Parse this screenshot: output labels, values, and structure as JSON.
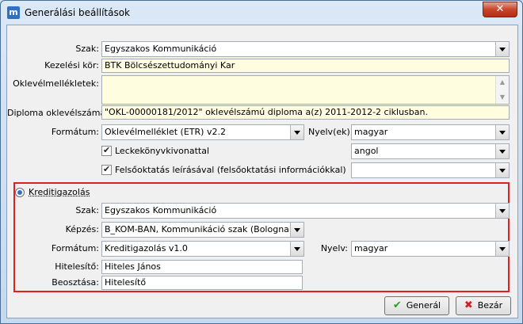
{
  "window": {
    "title": "Generálási beállítások",
    "app_icon_glyph": "m",
    "close_glyph": "✕"
  },
  "form": {
    "szak_label": "Szak:",
    "szak_value": "Egyszakos Kommunikáció",
    "kezelesi_label": "Kezelési kör:",
    "kezelesi_value": "BTK Bölcsészettudományi Kar",
    "oklevelm_label": "Oklevélmellékletek:",
    "diploma_label": "Diploma oklevélszáma:",
    "diploma_value": "\"OKL-00000181/2012\" oklevélszámú diploma a(z) 2011-2012-2 ciklusban.",
    "formatum_label": "Formátum:",
    "formatum_value": "Oklevélmelléklet (ETR) v2.2",
    "nyelvek_label": "Nyelv(ek):",
    "nyelv1_value": "magyar",
    "nyelv2_value": "angol",
    "nyelv3_value": "",
    "lecke_label": "Leckekönyvkivonattal",
    "felso_label": "Felsőoktatás leírásával (felsőoktatási információkkal)"
  },
  "kredit": {
    "radio_label": "Kreditigazolás",
    "szak_label": "Szak:",
    "szak_value": "Egyszakos Kommunikáció",
    "kepzes_label": "Képzés:",
    "kepzes_value": "B_KOM-BAN, Kommunikáció szak (Bolognai BTK)",
    "formatum_label": "Formátum:",
    "formatum_value": "Kreditigazolás v1.0",
    "nyelv_label": "Nyelv:",
    "nyelv_value": "magyar",
    "hitelesito_label": "Hitelesítő:",
    "hitelesito_value": "Hiteles János",
    "beosztas_label": "Beosztása:",
    "beosztas_value": "Hitelesítő"
  },
  "buttons": {
    "generate_label": "Generál",
    "close_label": "Bezár"
  },
  "colors": {
    "highlight": "#e02020",
    "readonly_bg": "#fffde0",
    "ok_icon": "#2e9a2e",
    "cancel_icon": "#d42020"
  }
}
